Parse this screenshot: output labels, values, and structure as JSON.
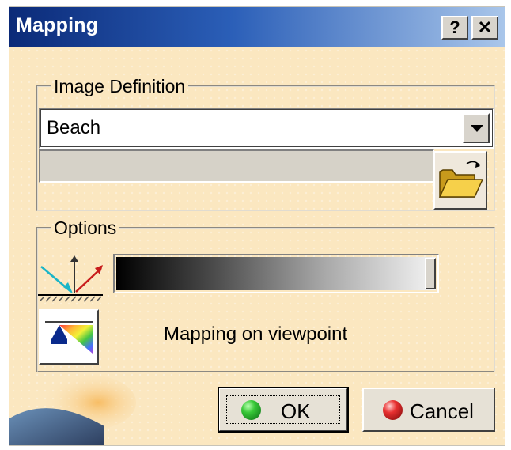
{
  "window": {
    "title": "Mapping",
    "help_label": "?",
    "close_label": "✕"
  },
  "image_definition": {
    "legend": "Image Definition",
    "selected_image": "Beach",
    "path_value": "",
    "browse_icon": "folder-open-icon"
  },
  "options": {
    "legend": "Options",
    "slider_value_fraction": 1.0,
    "axes_icon": "axes-reflection-icon",
    "mapping_icon": "prism-spectrum-icon",
    "mapping_label": "Mapping on viewpoint"
  },
  "buttons": {
    "ok_label": "OK",
    "cancel_label": "Cancel"
  },
  "colors": {
    "title_start": "#0b2a78",
    "title_end": "#a9c6ea",
    "dialog_bg": "#fbe7c0",
    "ok_icon": "#38c838",
    "cancel_icon": "#e83030"
  }
}
